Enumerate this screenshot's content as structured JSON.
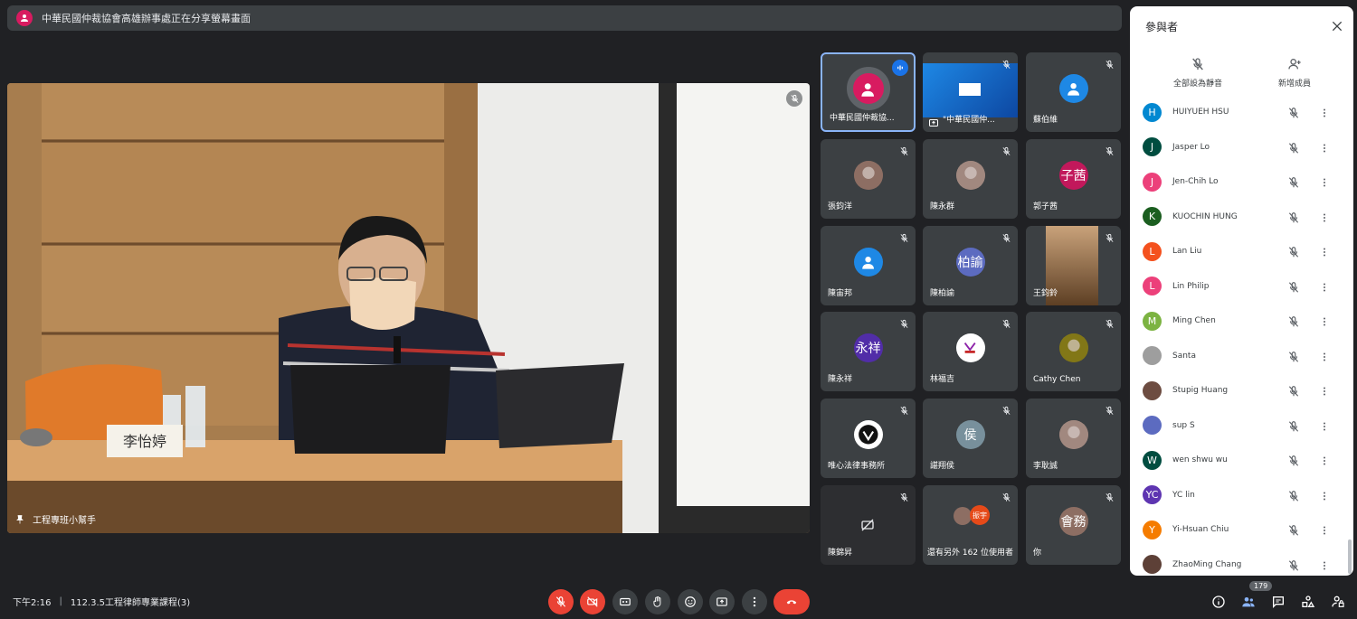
{
  "banner": {
    "text": "中華民國仲裁協會高雄辦事處正在分享螢幕畫面",
    "icon": "person-icon"
  },
  "main_video": {
    "presenter_label": "工程專班小幫手",
    "name_card": "李怡婷"
  },
  "tiles": [
    {
      "name": "中華民國仲裁協...",
      "avatar_text": "",
      "avatar_color": "#d81b60",
      "type": "speaking"
    },
    {
      "name": "\"中華民國仲...",
      "avatar_text": "",
      "avatar_color": "#1565c0",
      "type": "screen"
    },
    {
      "name": "蘇伯維",
      "avatar_text": "",
      "avatar_color": "#1e88e5",
      "type": "person"
    },
    {
      "name": "張鈞洋",
      "avatar_text": "",
      "avatar_color": "#8d6e63",
      "type": "photo"
    },
    {
      "name": "陳永群",
      "avatar_text": "",
      "avatar_color": "#a1887f",
      "type": "photo"
    },
    {
      "name": "郭子茜",
      "avatar_text": "子茜",
      "avatar_color": "#c2185b",
      "type": "initials"
    },
    {
      "name": "陳宙邦",
      "avatar_text": "",
      "avatar_color": "#1e88e5",
      "type": "person"
    },
    {
      "name": "陳柏諭",
      "avatar_text": "柏諭",
      "avatar_color": "#5c6bc0",
      "type": "initials"
    },
    {
      "name": "王鈞鈴",
      "avatar_text": "",
      "avatar_color": "#795548",
      "type": "video"
    },
    {
      "name": "陳永祥",
      "avatar_text": "永祥",
      "avatar_color": "#512da8",
      "type": "initials"
    },
    {
      "name": "林福吉",
      "avatar_text": "",
      "avatar_color": "#ffffff",
      "type": "logo"
    },
    {
      "name": "Cathy Chen",
      "avatar_text": "",
      "avatar_color": "#827717",
      "type": "photo"
    },
    {
      "name": "唯心法律事務所",
      "avatar_text": "",
      "avatar_color": "#ffffff",
      "type": "logo2"
    },
    {
      "name": "諶翔侯",
      "avatar_text": "侯",
      "avatar_color": "#78909c",
      "type": "initials"
    },
    {
      "name": "李耿誠",
      "avatar_text": "",
      "avatar_color": "#a1887f",
      "type": "photo"
    },
    {
      "name": "陳錦昇",
      "avatar_text": "",
      "avatar_color": "#3c4043",
      "type": "video-off"
    },
    {
      "name": "還有另外 162 位使用者",
      "avatar_text": "振宇",
      "avatar_color": "#e64a19",
      "type": "others"
    },
    {
      "name": "你",
      "avatar_text": "會務",
      "avatar_color": "#8d6e63",
      "type": "initials"
    }
  ],
  "panel": {
    "title": "參與者",
    "mute_all_label": "全部設為靜音",
    "add_member_label": "新增成員",
    "participants": [
      {
        "initial": "H",
        "name": "HUIYUEH HSU",
        "color": "#0288d1"
      },
      {
        "initial": "J",
        "name": "Jasper Lo",
        "color": "#004d40"
      },
      {
        "initial": "J",
        "name": "Jen-Chih Lo",
        "color": "#ec407a"
      },
      {
        "initial": "K",
        "name": "KUOCHIN HUNG",
        "color": "#1b5e20"
      },
      {
        "initial": "L",
        "name": "Lan Liu",
        "color": "#f4511e"
      },
      {
        "initial": "L",
        "name": "Lin Philip",
        "color": "#ec407a"
      },
      {
        "initial": "M",
        "name": "Ming Chen",
        "color": "#7cb342"
      },
      {
        "initial": "",
        "name": "Santa",
        "color": "#9e9e9e"
      },
      {
        "initial": "",
        "name": "Stupig Huang",
        "color": "#6d4c41"
      },
      {
        "initial": "",
        "name": "sup S",
        "color": "#5c6bc0"
      },
      {
        "initial": "W",
        "name": "wen shwu wu",
        "color": "#004d40"
      },
      {
        "initial": "YC",
        "name": "YC lin",
        "color": "#5e35b1"
      },
      {
        "initial": "Y",
        "name": "Yi-Hsuan Chiu",
        "color": "#f57c00"
      },
      {
        "initial": "",
        "name": "ZhaoMing Chang",
        "color": "#5d4037"
      }
    ]
  },
  "bottom": {
    "time": "下午2:16",
    "meeting_title": "112.3.5工程律師專業課程(3)",
    "participant_count": "179"
  }
}
